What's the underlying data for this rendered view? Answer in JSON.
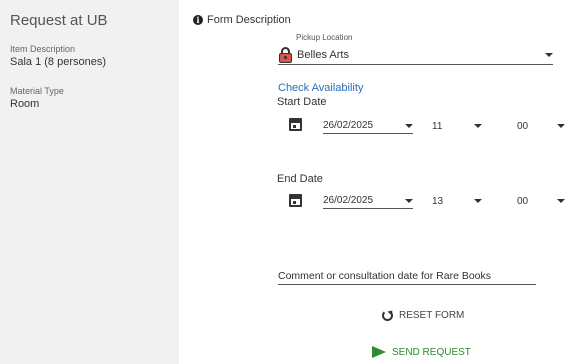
{
  "left": {
    "title": "Request at UB",
    "item_description_label": "Item Description",
    "item_description_value": "Sala 1 (8 persones)",
    "material_type_label": "Material Type",
    "material_type_value": "Room"
  },
  "form": {
    "description_label": "Form Description",
    "pickup_label": "Pickup Location",
    "pickup_value": "Belles Arts",
    "check_availability": "Check Availability",
    "start": {
      "heading": "Start Date",
      "date": "26/02/2025",
      "hour": "11",
      "minute": "00"
    },
    "end": {
      "heading": "End Date",
      "date": "26/02/2025",
      "hour": "13",
      "minute": "00"
    },
    "comment_placeholder": "Comment or consultation date for Rare Books",
    "reset_label": "RESET FORM",
    "send_label": "SEND REQUEST"
  },
  "icons": {
    "info": "info-icon",
    "lock": "lock-icon",
    "calendar": "calendar-icon",
    "caret": "chevron-down-icon",
    "reset": "refresh-icon",
    "send": "send-icon"
  },
  "colors": {
    "link": "#2a6ebb",
    "send": "#2e8b2e",
    "lock": "#d9534f",
    "left_panel_bg": "#f1f1f1"
  }
}
